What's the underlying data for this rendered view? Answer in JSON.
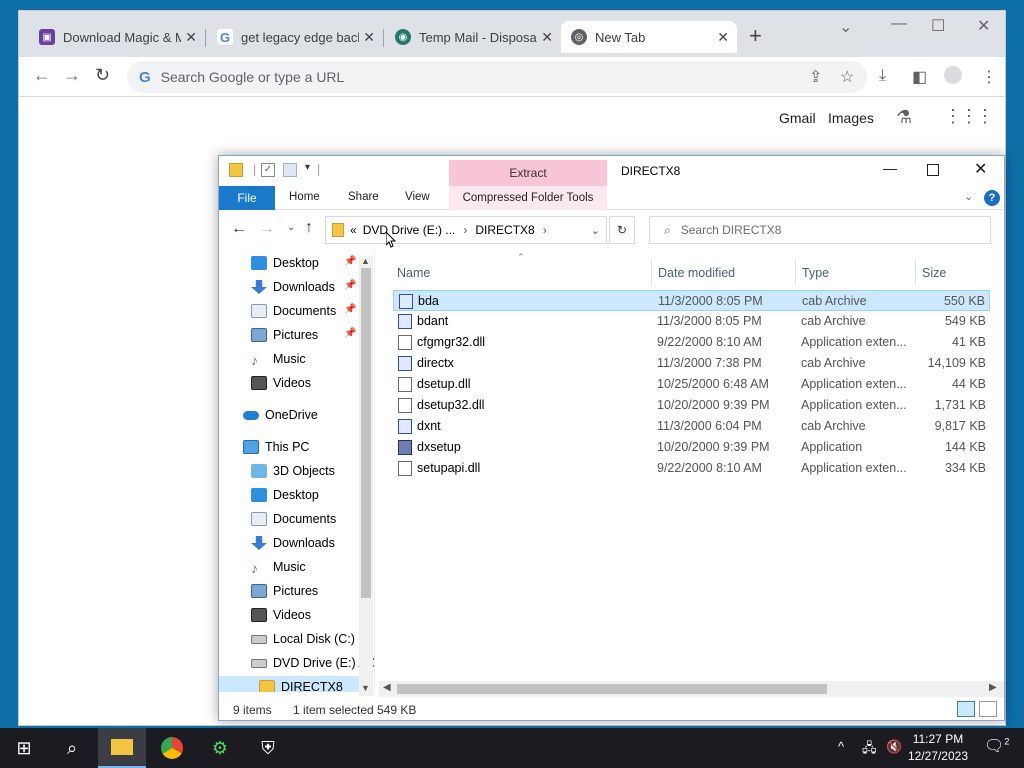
{
  "browser": {
    "tabs": [
      {
        "label": "Download Magic & M",
        "icon": "magic-app-icon",
        "color": "#6b3fa0"
      },
      {
        "label": "get legacy edge back",
        "icon": "google-icon",
        "color": "#4285f4"
      },
      {
        "label": "Temp Mail - Disposab",
        "icon": "tempmail-icon",
        "color": "#1f7a6b"
      },
      {
        "label": "New Tab",
        "icon": "chrome-icon",
        "color": "#4285f4"
      }
    ],
    "omnibox_placeholder": "Search Google or type a URL",
    "google_g": "G",
    "newtab": {
      "gmail": "Gmail",
      "images": "Images"
    }
  },
  "explorer": {
    "context_tab": "Extract",
    "window_title": "DIRECTX8",
    "ribbon_tabs": {
      "file": "File",
      "home": "Home",
      "share": "Share",
      "view": "View",
      "compressed": "Compressed Folder Tools"
    },
    "address": {
      "prefix": "«",
      "drive": "DVD Drive (E:) ...",
      "folder": "DIRECTX8"
    },
    "search_placeholder": "Search DIRECTX8",
    "nav": [
      {
        "label": "Desktop",
        "pinned": true
      },
      {
        "label": "Downloads",
        "pinned": true
      },
      {
        "label": "Documents",
        "pinned": true
      },
      {
        "label": "Pictures",
        "pinned": true
      },
      {
        "label": "Music"
      },
      {
        "label": "Videos"
      },
      {
        "label": "OneDrive"
      },
      {
        "label": "This PC"
      },
      {
        "label": "3D Objects"
      },
      {
        "label": "Desktop"
      },
      {
        "label": "Documents"
      },
      {
        "label": "Downloads"
      },
      {
        "label": "Music"
      },
      {
        "label": "Pictures"
      },
      {
        "label": "Videos"
      },
      {
        "label": "Local Disk (C:)"
      },
      {
        "label": "DVD Drive (E:) AC"
      },
      {
        "label": "DIRECTX8"
      }
    ],
    "columns": {
      "name": "Name",
      "date": "Date modified",
      "type": "Type",
      "size": "Size"
    },
    "files": [
      {
        "name": "bda",
        "date": "11/3/2000 8:05 PM",
        "type": "cab Archive",
        "size": "550 KB",
        "icon": "cab",
        "selected": true
      },
      {
        "name": "bdant",
        "date": "11/3/2000 8:05 PM",
        "type": "cab Archive",
        "size": "549 KB",
        "icon": "cab"
      },
      {
        "name": "cfgmgr32.dll",
        "date": "9/22/2000 8:10 AM",
        "type": "Application exten...",
        "size": "41 KB",
        "icon": "dll"
      },
      {
        "name": "directx",
        "date": "11/3/2000 7:38 PM",
        "type": "cab Archive",
        "size": "14,109 KB",
        "icon": "cab"
      },
      {
        "name": "dsetup.dll",
        "date": "10/25/2000 6:48 AM",
        "type": "Application exten...",
        "size": "44 KB",
        "icon": "dll"
      },
      {
        "name": "dsetup32.dll",
        "date": "10/20/2000 9:39 PM",
        "type": "Application exten...",
        "size": "1,731 KB",
        "icon": "dll"
      },
      {
        "name": "dxnt",
        "date": "11/3/2000 6:04 PM",
        "type": "cab Archive",
        "size": "9,817 KB",
        "icon": "cab"
      },
      {
        "name": "dxsetup",
        "date": "10/20/2000 9:39 PM",
        "type": "Application",
        "size": "144 KB",
        "icon": "app"
      },
      {
        "name": "setupapi.dll",
        "date": "9/22/2000 8:10 AM",
        "type": "Application exten...",
        "size": "334 KB",
        "icon": "dll"
      }
    ],
    "status": {
      "count": "9 items",
      "selected": "1 item selected",
      "size": "549 KB"
    }
  },
  "taskbar": {
    "time": "11:27 PM",
    "date": "12/27/2023",
    "notifications": "2"
  }
}
